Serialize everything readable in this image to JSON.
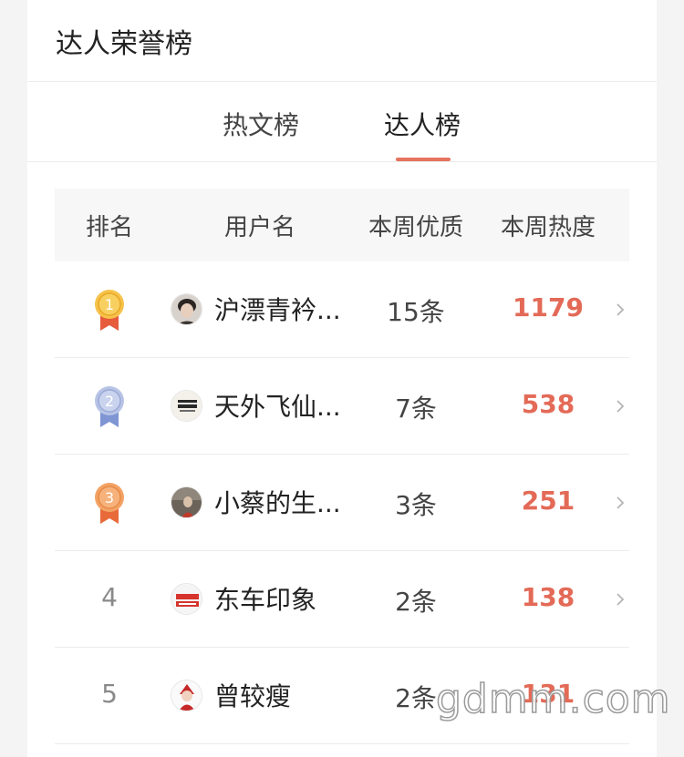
{
  "header": {
    "title": "达人荣誉榜"
  },
  "tabs": [
    {
      "label": "热文榜",
      "active": false
    },
    {
      "label": "达人榜",
      "active": true
    }
  ],
  "colors": {
    "accent": "#e5735d",
    "heat": "#e36a57",
    "gold": "#f0b22c",
    "silver": "#a9b7de",
    "bronze": "#f19a5a"
  },
  "table": {
    "headers": {
      "rank": "排名",
      "user": "用户名",
      "quality": "本周优质",
      "heat": "本周热度"
    },
    "rows": [
      {
        "rank": "1",
        "medal": "gold-medal-icon",
        "name": "沪漂青衿...",
        "count": "15条",
        "heat": "1179"
      },
      {
        "rank": "2",
        "medal": "silver-medal-icon",
        "name": "天外飞仙...",
        "count": "7条",
        "heat": "538"
      },
      {
        "rank": "3",
        "medal": "bronze-medal-icon",
        "name": "小蔡的生...",
        "count": "3条",
        "heat": "251"
      },
      {
        "rank": "4",
        "medal": "",
        "name": "东车印象",
        "count": "2条",
        "heat": "138"
      },
      {
        "rank": "5",
        "medal": "",
        "name": "曾较瘦",
        "count": "2条",
        "heat": "131"
      }
    ]
  },
  "watermark": "gdmm.com"
}
